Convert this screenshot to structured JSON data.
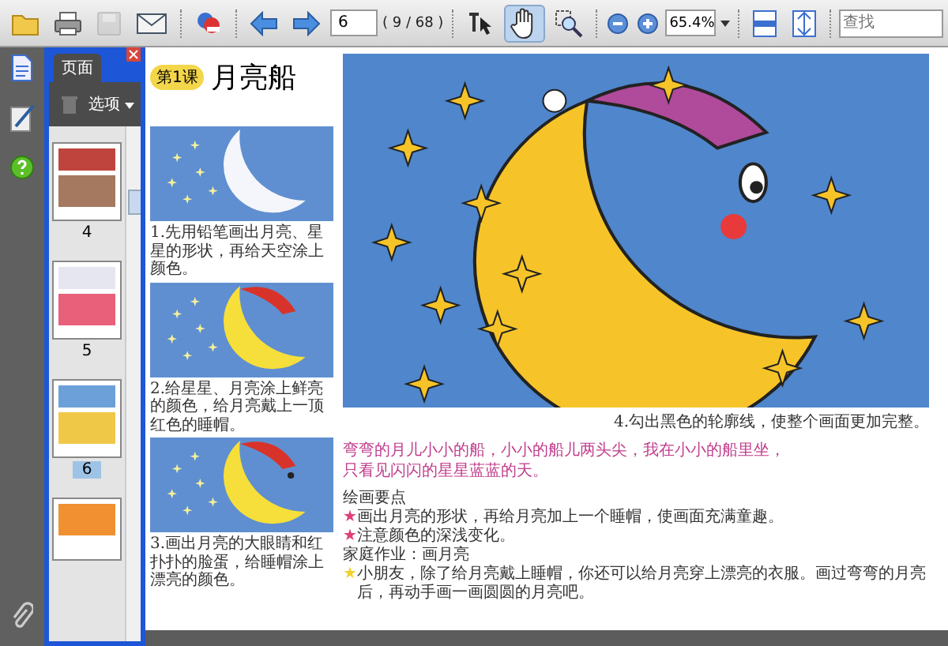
{
  "toolbar": {
    "file_buttons": [
      {
        "kind": "open",
        "disabled": false
      },
      {
        "kind": "print",
        "disabled": false
      },
      {
        "kind": "save",
        "disabled": true
      },
      {
        "kind": "email",
        "disabled": false
      },
      {
        "kind": "organize",
        "disabled": false
      }
    ],
    "page_field": "6",
    "page_count": "( 9 / 68 )",
    "tools": [
      {
        "kind": "select",
        "selected": false
      },
      {
        "kind": "hand",
        "selected": true
      },
      {
        "kind": "zoom",
        "selected": false
      }
    ],
    "zoom_field": "65.4%",
    "search": {
      "placeholder": "查找"
    }
  },
  "panel": {
    "tab": {
      "label": "页面",
      "selected": true
    },
    "options": "选项",
    "thumbnails": [
      {
        "label": "4",
        "selected": false
      },
      {
        "label": "5",
        "selected": false
      },
      {
        "label": "6",
        "selected": true
      }
    ]
  },
  "document": {
    "lesson_badge": "第1课",
    "title": "月亮船",
    "steps": [
      "1.先用铅笔画出月亮、星星的形状，再给天空涂上颜色。",
      "2.给星星、月亮涂上鲜亮的颜色，给月亮戴上一顶红色的睡帽。",
      "3.画出月亮的大眼睛和红扑扑的脸蛋，给睡帽涂上漂亮的颜色。"
    ],
    "main_caption": "4.勾出黑色的轮廓线，使整个画面更加完整。",
    "poem": [
      "弯弯的月儿小小的船，小小的船儿两头尖，我在小小的船里坐，",
      "只看见闪闪的星星蓝蓝的天。"
    ],
    "notes": [
      {
        "kind": "heading",
        "text": "绘画要点"
      },
      {
        "kind": "tip",
        "marker": "★",
        "color": "#e0407a",
        "text": "画出月亮的形状，再给月亮加上一个睡帽，使画面充满童趣。"
      },
      {
        "kind": "tip",
        "marker": "★",
        "color": "#e0407a",
        "text": "注意颜色的深浅变化。"
      },
      {
        "kind": "plain",
        "text": "家庭作业：画月亮"
      },
      {
        "kind": "tip",
        "marker": "★",
        "color": "#f2d233",
        "text": "小朋友，除了给月亮戴上睡帽，你还可以给月亮穿上漂亮的衣服。画过弯弯的月亮后，再动手画一画圆圆的月亮吧。"
      }
    ]
  }
}
